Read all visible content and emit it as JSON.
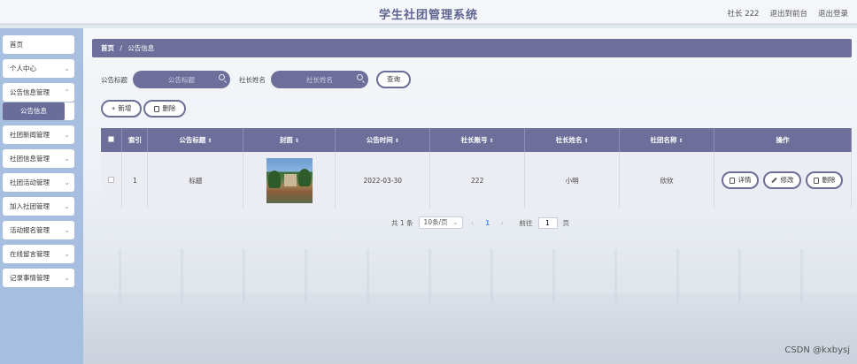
{
  "header": {
    "title": "学生社团管理系统",
    "user_label": "社长 222",
    "back_front_label": "退出到前台",
    "logout_label": "退出登录"
  },
  "sidebar": {
    "items": [
      {
        "label": "首页",
        "has_chevron": false
      },
      {
        "label": "个人中心",
        "has_chevron": true
      },
      {
        "label": "公告信息管理",
        "has_chevron": true
      },
      {
        "label": "社团新闻管理",
        "has_chevron": true
      },
      {
        "label": "社团信息管理",
        "has_chevron": true
      },
      {
        "label": "社团活动管理",
        "has_chevron": true
      },
      {
        "label": "加入社团管理",
        "has_chevron": true
      },
      {
        "label": "活动报名管理",
        "has_chevron": true
      },
      {
        "label": "在线留言管理",
        "has_chevron": true
      },
      {
        "label": "记录事情管理",
        "has_chevron": true
      }
    ],
    "active_sub": "公告信息"
  },
  "breadcrumb": {
    "home": "首页",
    "sep": "/",
    "current": "公告信息"
  },
  "search": {
    "title_label": "公告标题",
    "title_placeholder": "公告标题",
    "name_label": "社长姓名",
    "name_placeholder": "社长姓名",
    "query_label": "查询"
  },
  "actions": {
    "add_label": "新增",
    "delete_label": "删除"
  },
  "table": {
    "headers": [
      "索引",
      "公告标题",
      "封面",
      "公告时间",
      "社长账号",
      "社长姓名",
      "社团名称",
      "操作"
    ],
    "rows": [
      {
        "index": "1",
        "title": "标题",
        "time": "2022-03-30",
        "account": "222",
        "name": "小明",
        "club": "欣欣"
      }
    ],
    "op_detail": "详情",
    "op_edit": "修改",
    "op_delete": "删除"
  },
  "pager": {
    "total": "共 1 条",
    "page_size": "10条/页",
    "current_page": "1",
    "goto_label": "前往",
    "goto_value": "1",
    "page_suffix": "页",
    "prev": "‹",
    "next": "›"
  },
  "watermark": "CSDN @kxbysj"
}
